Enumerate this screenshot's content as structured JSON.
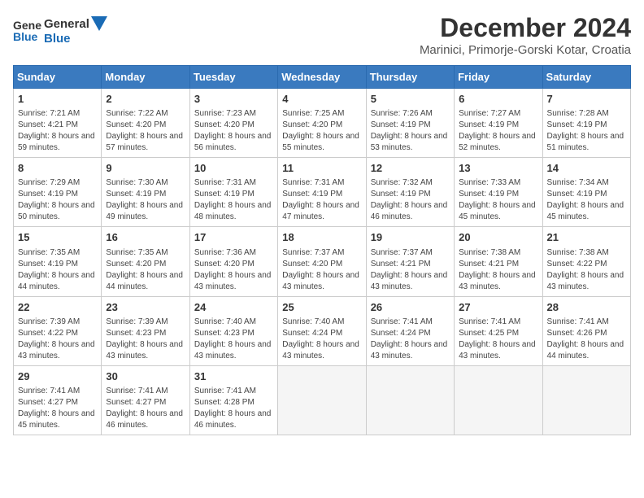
{
  "header": {
    "logo_general": "General",
    "logo_blue": "Blue",
    "title": "December 2024",
    "subtitle": "Marinici, Primorje-Gorski Kotar, Croatia"
  },
  "weekdays": [
    "Sunday",
    "Monday",
    "Tuesday",
    "Wednesday",
    "Thursday",
    "Friday",
    "Saturday"
  ],
  "weeks": [
    [
      {
        "day": "1",
        "sunrise": "7:21 AM",
        "sunset": "4:21 PM",
        "daylight": "8 hours and 59 minutes."
      },
      {
        "day": "2",
        "sunrise": "7:22 AM",
        "sunset": "4:20 PM",
        "daylight": "8 hours and 57 minutes."
      },
      {
        "day": "3",
        "sunrise": "7:23 AM",
        "sunset": "4:20 PM",
        "daylight": "8 hours and 56 minutes."
      },
      {
        "day": "4",
        "sunrise": "7:25 AM",
        "sunset": "4:20 PM",
        "daylight": "8 hours and 55 minutes."
      },
      {
        "day": "5",
        "sunrise": "7:26 AM",
        "sunset": "4:19 PM",
        "daylight": "8 hours and 53 minutes."
      },
      {
        "day": "6",
        "sunrise": "7:27 AM",
        "sunset": "4:19 PM",
        "daylight": "8 hours and 52 minutes."
      },
      {
        "day": "7",
        "sunrise": "7:28 AM",
        "sunset": "4:19 PM",
        "daylight": "8 hours and 51 minutes."
      }
    ],
    [
      {
        "day": "8",
        "sunrise": "7:29 AM",
        "sunset": "4:19 PM",
        "daylight": "8 hours and 50 minutes."
      },
      {
        "day": "9",
        "sunrise": "7:30 AM",
        "sunset": "4:19 PM",
        "daylight": "8 hours and 49 minutes."
      },
      {
        "day": "10",
        "sunrise": "7:31 AM",
        "sunset": "4:19 PM",
        "daylight": "8 hours and 48 minutes."
      },
      {
        "day": "11",
        "sunrise": "7:31 AM",
        "sunset": "4:19 PM",
        "daylight": "8 hours and 47 minutes."
      },
      {
        "day": "12",
        "sunrise": "7:32 AM",
        "sunset": "4:19 PM",
        "daylight": "8 hours and 46 minutes."
      },
      {
        "day": "13",
        "sunrise": "7:33 AM",
        "sunset": "4:19 PM",
        "daylight": "8 hours and 45 minutes."
      },
      {
        "day": "14",
        "sunrise": "7:34 AM",
        "sunset": "4:19 PM",
        "daylight": "8 hours and 45 minutes."
      }
    ],
    [
      {
        "day": "15",
        "sunrise": "7:35 AM",
        "sunset": "4:19 PM",
        "daylight": "8 hours and 44 minutes."
      },
      {
        "day": "16",
        "sunrise": "7:35 AM",
        "sunset": "4:20 PM",
        "daylight": "8 hours and 44 minutes."
      },
      {
        "day": "17",
        "sunrise": "7:36 AM",
        "sunset": "4:20 PM",
        "daylight": "8 hours and 43 minutes."
      },
      {
        "day": "18",
        "sunrise": "7:37 AM",
        "sunset": "4:20 PM",
        "daylight": "8 hours and 43 minutes."
      },
      {
        "day": "19",
        "sunrise": "7:37 AM",
        "sunset": "4:21 PM",
        "daylight": "8 hours and 43 minutes."
      },
      {
        "day": "20",
        "sunrise": "7:38 AM",
        "sunset": "4:21 PM",
        "daylight": "8 hours and 43 minutes."
      },
      {
        "day": "21",
        "sunrise": "7:38 AM",
        "sunset": "4:22 PM",
        "daylight": "8 hours and 43 minutes."
      }
    ],
    [
      {
        "day": "22",
        "sunrise": "7:39 AM",
        "sunset": "4:22 PM",
        "daylight": "8 hours and 43 minutes."
      },
      {
        "day": "23",
        "sunrise": "7:39 AM",
        "sunset": "4:23 PM",
        "daylight": "8 hours and 43 minutes."
      },
      {
        "day": "24",
        "sunrise": "7:40 AM",
        "sunset": "4:23 PM",
        "daylight": "8 hours and 43 minutes."
      },
      {
        "day": "25",
        "sunrise": "7:40 AM",
        "sunset": "4:24 PM",
        "daylight": "8 hours and 43 minutes."
      },
      {
        "day": "26",
        "sunrise": "7:41 AM",
        "sunset": "4:24 PM",
        "daylight": "8 hours and 43 minutes."
      },
      {
        "day": "27",
        "sunrise": "7:41 AM",
        "sunset": "4:25 PM",
        "daylight": "8 hours and 43 minutes."
      },
      {
        "day": "28",
        "sunrise": "7:41 AM",
        "sunset": "4:26 PM",
        "daylight": "8 hours and 44 minutes."
      }
    ],
    [
      {
        "day": "29",
        "sunrise": "7:41 AM",
        "sunset": "4:27 PM",
        "daylight": "8 hours and 45 minutes."
      },
      {
        "day": "30",
        "sunrise": "7:41 AM",
        "sunset": "4:27 PM",
        "daylight": "8 hours and 46 minutes."
      },
      {
        "day": "31",
        "sunrise": "7:41 AM",
        "sunset": "4:28 PM",
        "daylight": "8 hours and 46 minutes."
      },
      null,
      null,
      null,
      null
    ]
  ]
}
